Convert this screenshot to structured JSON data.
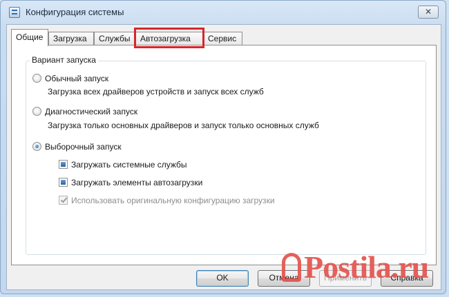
{
  "window": {
    "title": "Конфигурация системы",
    "close_glyph": "✕"
  },
  "tabs": [
    {
      "label": "Общие",
      "active": true
    },
    {
      "label": "Загрузка",
      "active": false
    },
    {
      "label": "Службы",
      "active": false
    },
    {
      "label": "Автозагрузка",
      "active": false,
      "highlighted": true
    },
    {
      "label": "Сервис",
      "active": false
    }
  ],
  "startup_group": {
    "label": "Вариант запуска",
    "normal": {
      "label": "Обычный запуск",
      "description": "Загрузка всех драйверов устройств и запуск всех служб",
      "selected": false
    },
    "diagnostic": {
      "label": "Диагностический запуск",
      "description": "Загрузка только основных драйверов и запуск только основных служб",
      "selected": false
    },
    "selective": {
      "label": "Выборочный запуск",
      "selected": true,
      "options": [
        {
          "label": "Загружать системные службы",
          "state": "indeterminate",
          "enabled": true
        },
        {
          "label": "Загружать элементы автозагрузки",
          "state": "indeterminate",
          "enabled": true
        },
        {
          "label": "Использовать оригинальную конфигурацию загрузки",
          "state": "checked",
          "enabled": false
        }
      ]
    }
  },
  "buttons": {
    "ok": "OK",
    "cancel": "Отмена",
    "apply": "Применить",
    "help": "Справка"
  },
  "watermark": {
    "text": "Postila.ru"
  },
  "colors": {
    "highlight_border": "#d6262b",
    "watermark": "#e5544f",
    "window_frame": "#c9dcf0"
  }
}
